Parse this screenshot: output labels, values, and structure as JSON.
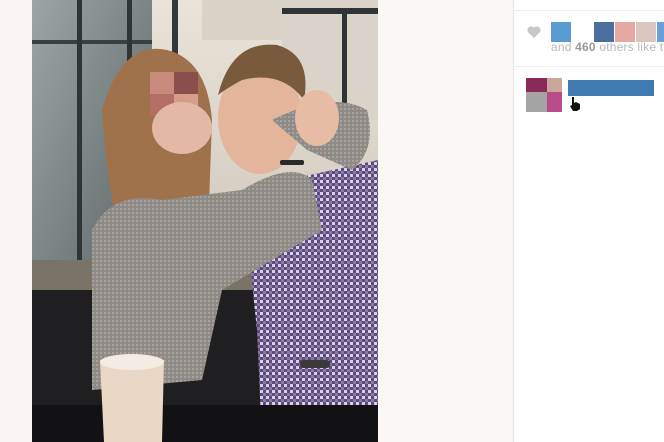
{
  "post": {
    "image_alt": "Photo of a couple embracing at a café window",
    "likes": {
      "prefix": "and ",
      "count": "460",
      "suffix": " others like this"
    },
    "comment": {
      "username": "",
      "avatar_colors": [
        "#8a2a5a",
        "#c9a79a",
        "#b84b8a",
        "#a4a4a4"
      ]
    },
    "liker_avatar_colors": [
      "#5b9bd5",
      "#4a6f9f",
      "#e3a9a0",
      "#dcc4c0",
      "#6aa0d8"
    ]
  },
  "colors": {
    "link_blue": "#3e7ab0",
    "muted_text": "#b8b8b8",
    "heart": "#c7c7c7"
  }
}
